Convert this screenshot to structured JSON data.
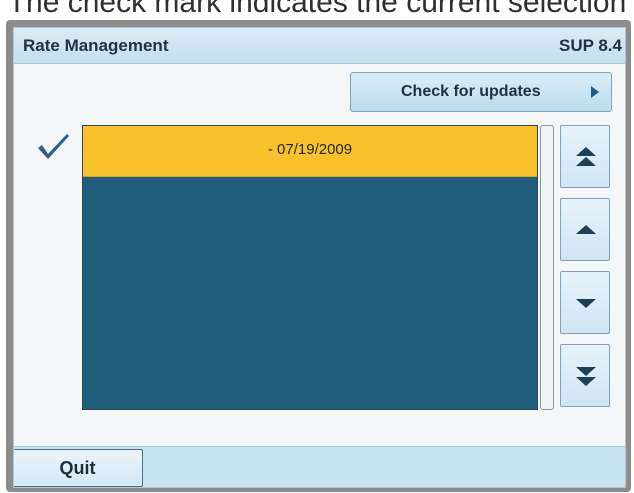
{
  "caption": "The check mark indicates the current selection",
  "header": {
    "title": "Rate Management",
    "version": "SUP 8.4"
  },
  "actions": {
    "check_updates_label": "Check for updates"
  },
  "list": {
    "items": [
      {
        "label": "- 07/19/2009",
        "selected": true
      }
    ]
  },
  "nav": {
    "first_icon": "double-chevron-up-icon",
    "up_icon": "chevron-up-icon",
    "down_icon": "chevron-down-icon",
    "last_icon": "double-chevron-down-icon"
  },
  "footer": {
    "quit_label": "Quit"
  },
  "colors": {
    "selected_row": "#f9c22b",
    "list_background": "#1f5e7a",
    "title_bar": "#c3dfee",
    "accent": "#1f5c82"
  }
}
